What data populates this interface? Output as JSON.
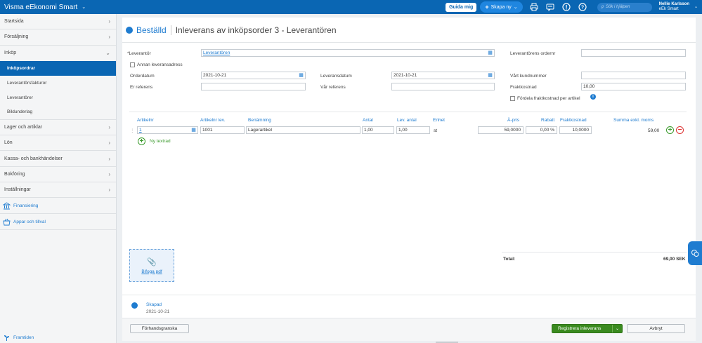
{
  "app": {
    "title": "Visma eEkonomi Smart"
  },
  "topbar": {
    "guide_label": "Guida mig",
    "create_label": "Skapa ny",
    "search_placeholder": "Sök i hjälpen",
    "user_name": "Nellie Karlsson",
    "user_company": "eEk Smart"
  },
  "sidebar": {
    "items": [
      {
        "label": "Startsida"
      },
      {
        "label": "Försäljning"
      },
      {
        "label": "Inköp"
      },
      {
        "label": "Lager och artiklar"
      },
      {
        "label": "Lön"
      },
      {
        "label": "Kassa- och bankhändelser"
      },
      {
        "label": "Bokföring"
      },
      {
        "label": "Inställningar"
      }
    ],
    "subitems": [
      {
        "label": "Inköpsordrar"
      },
      {
        "label": "Leverantörsfakturor"
      },
      {
        "label": "Leverantörer"
      },
      {
        "label": "Bildunderlag"
      }
    ],
    "special": [
      {
        "label": "Finansiering",
        "icon": "bank-icon"
      },
      {
        "label": "Appar och tillval",
        "icon": "basket-icon"
      }
    ],
    "bottom": {
      "label": "Framtiden",
      "icon": "sprout-icon"
    }
  },
  "header": {
    "status": "Beställd",
    "title": "Inleverans av inköpsorder 3 - Leverantören"
  },
  "form": {
    "supplier_label": "*Leverantör",
    "supplier_value": "Leverantören",
    "other_address_label": "Annan leveransadress",
    "order_date_label": "Orderdatum",
    "order_date_value": "2021-10-21",
    "your_ref_label": "Er referens",
    "your_ref_value": "",
    "delivery_date_label": "Leveransdatum",
    "delivery_date_value": "2021-10-21",
    "our_ref_label": "Vår referens",
    "our_ref_value": "",
    "supplier_order_label": "Leverantörens ordernr",
    "supplier_order_value": "",
    "customer_no_label": "Vårt kundnummer",
    "customer_no_value": "",
    "freight_label": "Fraktkostnad",
    "freight_value": "10,00",
    "distribute_freight_label": "Fördela fraktkostnad per artikel"
  },
  "table": {
    "headers": {
      "article_no": "Artikelnr",
      "supplier_article_no": "Artikelnr lev.",
      "name": "Benämning",
      "quantity": "Antal",
      "delivered_qty": "Lev. antal",
      "unit": "Enhet",
      "unit_price": "À-pris",
      "discount": "Rabatt",
      "freight": "Fraktkostnad",
      "sum": "Summa exkl. moms"
    },
    "rows": [
      {
        "article_no": "1",
        "supplier_article_no": "1001",
        "name": "Lagerartikel",
        "quantity": "1,00",
        "delivered_qty": "1,00",
        "unit": "st",
        "unit_price": "59,0000",
        "discount": "0,00 %",
        "freight": "10,0000",
        "sum": "59,00"
      }
    ],
    "new_row_label": "Ny textrad"
  },
  "attachment": {
    "label": "Bifoga pdf"
  },
  "totals": {
    "label": "Total:",
    "value": "69,00 SEK"
  },
  "history": {
    "event": "Skapad",
    "date": "2021-10-21"
  },
  "footer": {
    "preview_label": "Förhandsgranska",
    "register_label": "Registrera inleverans",
    "cancel_label": "Avbryt"
  }
}
